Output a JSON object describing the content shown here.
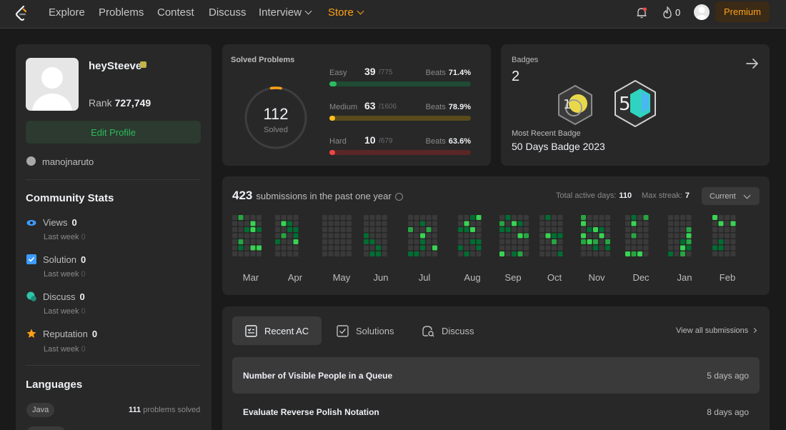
{
  "nav": {
    "items": [
      "Explore",
      "Problems",
      "Contest",
      "Discuss"
    ],
    "interview": "Interview",
    "store": "Store",
    "streak": "0",
    "premium": "Premium"
  },
  "profile": {
    "username": "heySteeve",
    "rank_label": "Rank",
    "rank_value": "727,749",
    "edit_profile": "Edit Profile",
    "github": "manojnaruto"
  },
  "community": {
    "title": "Community Stats",
    "stats": [
      {
        "label": "Views",
        "value": "0",
        "sub": "Last week",
        "sub_value": "0",
        "icon": "eye-icon",
        "color": "#3c9cff"
      },
      {
        "label": "Solution",
        "value": "0",
        "sub": "Last week",
        "sub_value": "0",
        "icon": "check-box-icon",
        "color": "#3c9cff"
      },
      {
        "label": "Discuss",
        "value": "0",
        "sub": "Last week",
        "sub_value": "0",
        "icon": "chat-bubble-icon",
        "color": "#2dc6a8"
      },
      {
        "label": "Reputation",
        "value": "0",
        "sub": "Last week",
        "sub_value": "0",
        "icon": "star-icon",
        "color": "#ffa116"
      }
    ]
  },
  "languages": {
    "title": "Languages",
    "items": [
      {
        "name": "Java",
        "count": "111",
        "suffix": "problems solved"
      }
    ]
  },
  "solved": {
    "title": "Solved Problems",
    "total": "112",
    "total_label": "Solved",
    "beats_label": "Beats",
    "difficulties": [
      {
        "name": "Easy",
        "count": "39",
        "total": "/775",
        "beats": "71.4%",
        "fraction": 0.05,
        "color": "#2cbb5d",
        "track": "#1f4a34"
      },
      {
        "name": "Medium",
        "count": "63",
        "total": "/1606",
        "beats": "78.9%",
        "fraction": 0.04,
        "color": "#ffc01e",
        "track": "#5a4a1c"
      },
      {
        "name": "Hard",
        "count": "10",
        "total": "/679",
        "beats": "63.6%",
        "fraction": 0.015,
        "color": "#ef4743",
        "track": "#5a2626"
      }
    ]
  },
  "badges": {
    "label": "Badges",
    "count": "2",
    "recent_label": "Most Recent Badge",
    "recent_name": "50 Days Badge 2023"
  },
  "submissions": {
    "count": "423",
    "text": "submissions in the past one year",
    "active_label": "Total active days:",
    "active_value": "110",
    "streak_label": "Max streak:",
    "streak_value": "7",
    "period": "Current",
    "months": [
      "Mar",
      "Apr",
      "May",
      "Jun",
      "Jul",
      "Aug",
      "Sep",
      "Oct",
      "Nov",
      "Dec",
      "Jan",
      "Feb"
    ],
    "colors": [
      "#3a3a3a",
      "#0e4429",
      "#006d32",
      "#26a641",
      "#39d353"
    ]
  },
  "recent": {
    "tabs": [
      {
        "label": "Recent AC",
        "icon": "list-check-icon"
      },
      {
        "label": "Solutions",
        "icon": "check-square-icon"
      },
      {
        "label": "Discuss",
        "icon": "discuss-search-icon"
      }
    ],
    "view_all": "View all submissions",
    "items": [
      {
        "title": "Number of Visible People in a Queue",
        "time": "5 days ago"
      },
      {
        "title": "Evaluate Reverse Polish Notation",
        "time": "8 days ago"
      }
    ]
  }
}
